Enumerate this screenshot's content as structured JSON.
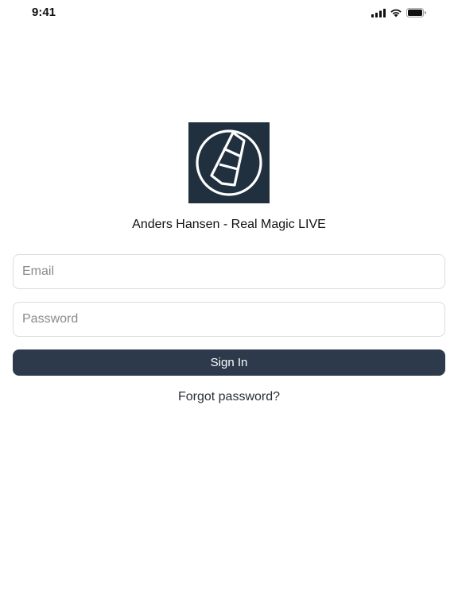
{
  "status_bar": {
    "time": "9:41",
    "icons": [
      "cellular-signal-icon",
      "wifi-icon",
      "battery-icon"
    ]
  },
  "logo": {
    "icon": "buoy-logo-icon",
    "background_color": "#21303f"
  },
  "app": {
    "title": "Anders Hansen - Real Magic LIVE"
  },
  "form": {
    "email": {
      "value": "",
      "placeholder": "Email"
    },
    "password": {
      "value": "",
      "placeholder": "Password"
    },
    "sign_in_label": "Sign In",
    "forgot_password_label": "Forgot password?"
  },
  "colors": {
    "primary_button": "#2c3a4b",
    "button_text": "#ffffff",
    "field_border": "#dcdcdc",
    "placeholder": "#8a8a8a"
  }
}
